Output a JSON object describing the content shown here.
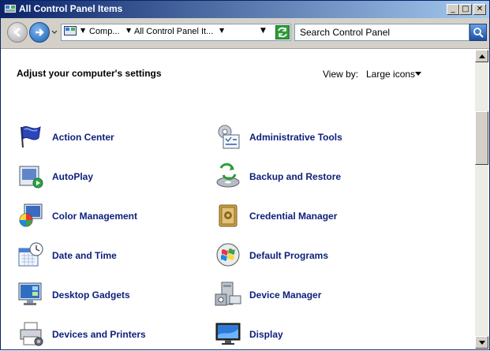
{
  "window": {
    "title": "All Control Panel Items"
  },
  "titlebar_buttons": {
    "minimize": "_",
    "maximize": "□",
    "close": "✕"
  },
  "address": {
    "crumbs": [
      "Comp...",
      "All Control Panel It..."
    ]
  },
  "search": {
    "placeholder": "Search Control Panel"
  },
  "content": {
    "heading": "Adjust your computer's settings",
    "view_by_label": "View by:",
    "view_by_value": "Large icons"
  },
  "items": [
    {
      "label": "Action Center",
      "icon": "flag-icon"
    },
    {
      "label": "Administrative Tools",
      "icon": "admin-tools-icon"
    },
    {
      "label": "AutoPlay",
      "icon": "autoplay-icon"
    },
    {
      "label": "Backup and Restore",
      "icon": "backup-icon"
    },
    {
      "label": "Color Management",
      "icon": "color-management-icon"
    },
    {
      "label": "Credential Manager",
      "icon": "credential-icon"
    },
    {
      "label": "Date and Time",
      "icon": "clock-icon"
    },
    {
      "label": "Default Programs",
      "icon": "default-programs-icon"
    },
    {
      "label": "Desktop Gadgets",
      "icon": "gadgets-icon"
    },
    {
      "label": "Device Manager",
      "icon": "device-manager-icon"
    },
    {
      "label": "Devices and Printers",
      "icon": "printer-icon"
    },
    {
      "label": "Display",
      "icon": "display-icon"
    }
  ],
  "colors": {
    "title_start": "#0a246a",
    "title_end": "#a6caf0",
    "link": "#0b1f7a"
  }
}
